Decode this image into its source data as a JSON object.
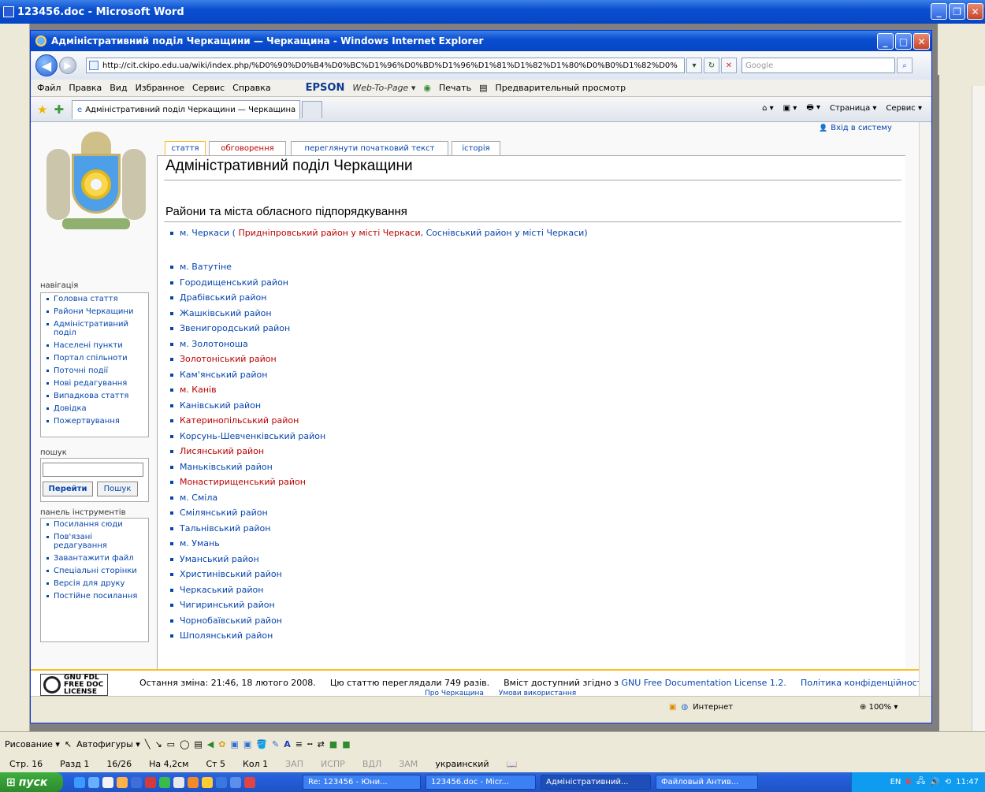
{
  "word": {
    "title": "123456.doc - Microsoft Word",
    "draw_bar": {
      "draw": "Рисование ▾",
      "autoshapes": "Автофигуры ▾"
    },
    "status": [
      "Стр. 16",
      "Разд 1",
      "16/26",
      "На 4,2см",
      "Ст 5",
      "Кол 1"
    ],
    "status_dim": [
      "ЗАП",
      "ИСПР",
      "ВДЛ",
      "ЗАМ"
    ],
    "language": "украинский"
  },
  "ie": {
    "title": "Адміністративний поділ Черкащини — Черкащина - Windows Internet Explorer",
    "url": "http://cit.ckipo.edu.ua/wiki/index.php/%D0%90%D0%B4%D0%BC%D1%96%D0%BD%D1%96%D1%81%D1%82%D1%80%D0%B0%D1%82%D0%",
    "search_placeholder": "Google",
    "menu": [
      "Файл",
      "Правка",
      "Вид",
      "Избранное",
      "Сервис",
      "Справка"
    ],
    "epson": "EPSON",
    "web_to_page": "Web-To-Page ▾",
    "print": "Печать",
    "preview": "Предварительный просмотр",
    "tab_title": "Адміністративний поділ Черкащини — Черкащина",
    "cmd": {
      "page": "Страница ▾",
      "service": "Сервис ▾"
    },
    "status_zone": "Интернет",
    "zoom": "100%"
  },
  "wiki": {
    "login": "Вхід в систему",
    "tabs": [
      "стаття",
      "обговорення",
      "переглянути початковий текст",
      "історія"
    ],
    "page_title": "Адміністративний поділ Черкащини",
    "section_head": "Райони та міста обласного підпорядкування",
    "cherkasy": {
      "prefix": "м. Черкаси",
      "open": " ( ",
      "red_link": "Придніпровський район у місті Черкаси",
      "sep": ", ",
      "blue_link": "Соснівський район у місті Черкаси",
      "close": ")"
    },
    "items": [
      {
        "text": "м. Ватутіне",
        "red": false
      },
      {
        "text": "Городищенський район",
        "red": false
      },
      {
        "text": "Драбівський район",
        "red": false
      },
      {
        "text": "Жашківський район",
        "red": false
      },
      {
        "text": "Звенигородський район",
        "red": false
      },
      {
        "text": "м. Золотоноша",
        "red": false
      },
      {
        "text": "Золотоніський район",
        "red": true
      },
      {
        "text": "Кам'янський район",
        "red": false
      },
      {
        "text": "м. Канів",
        "red": true
      },
      {
        "text": "Канівський район",
        "red": false
      },
      {
        "text": "Катеринопільський район",
        "red": true
      },
      {
        "text": "Корсунь-Шевченківський район",
        "red": false
      },
      {
        "text": "Лисянський район",
        "red": true
      },
      {
        "text": "Маньківський район",
        "red": false
      },
      {
        "text": "Монастирищенський район",
        "red": true
      },
      {
        "text": "м. Сміла",
        "red": false
      },
      {
        "text": "Смілянський район",
        "red": false
      },
      {
        "text": "Тальнівський район",
        "red": false
      },
      {
        "text": "м. Умань",
        "red": false
      },
      {
        "text": "Уманський район",
        "red": false
      },
      {
        "text": "Христинівський район",
        "red": false
      },
      {
        "text": "Черкаський район",
        "red": false
      },
      {
        "text": "Чигиринський район",
        "red": false
      },
      {
        "text": "Чорнобаївський район",
        "red": false
      },
      {
        "text": "Шполянський район",
        "red": false
      }
    ],
    "nav_head": "навігація",
    "nav": [
      "Головна стаття",
      "Райони Черкащини",
      "Адміністративний поділ",
      "Населені пункти",
      "Портал спільноти",
      "Поточні події",
      "Нові редагування",
      "Випадкова стаття",
      "Довідка",
      "Пожертвування"
    ],
    "search_head": "пошук",
    "go_btn": "Перейти",
    "search_btn": "Пошук",
    "tools_head": "панель інструментів",
    "tools": [
      "Посилання сюди",
      "Пов'язані редагування",
      "Завантажити файл",
      "Спеціальні сторінки",
      "Версія для друку",
      "Постійне посилання"
    ],
    "footer": {
      "gfdl1": "GNU FDL",
      "gfdl2": "FREE DOC",
      "gfdl3": "LICENSE",
      "last_change": "Остання зміна: 21:46, 18 лютого 2008.",
      "views": "Цю статтю переглядали 749 разів.",
      "license_prefix": "Вміст доступний згідно з",
      "license_link": "GNU Free Documentation License 1.2.",
      "privacy": "Політика конфіденційності",
      "about": "Про Черкащина",
      "terms": "Умови використання"
    }
  },
  "taskbar": {
    "start": "пуск",
    "tasks": [
      "Re: 123456 - Юни...",
      "123456.doc - Micr...",
      "Адміністративний...",
      "Файловый Антив..."
    ],
    "lang": "EN",
    "clock": "11:47"
  }
}
